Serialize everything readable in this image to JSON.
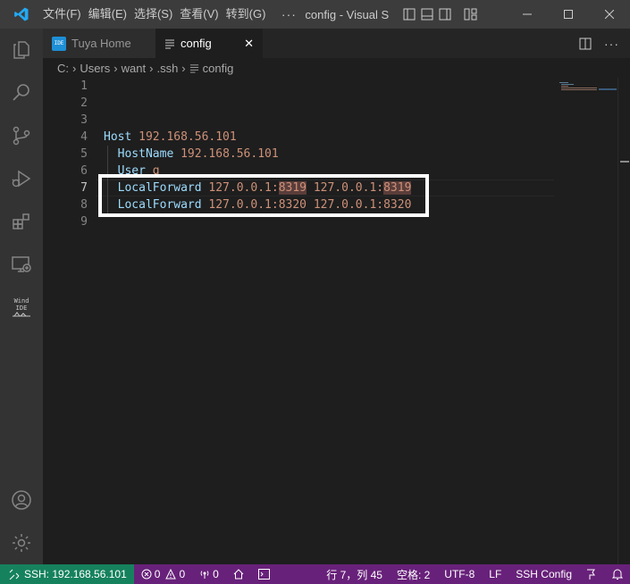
{
  "titlebar": {
    "menus": [
      "文件(F)",
      "编辑(E)",
      "选择(S)",
      "查看(V)",
      "转到(G)"
    ],
    "more": "···",
    "title": "config - Visual S"
  },
  "tabs": [
    {
      "label": "Tuya Home",
      "icon": "tuya-home-icon",
      "active": false
    },
    {
      "label": "config",
      "icon": "file-lines-icon",
      "active": true,
      "close": "✕"
    }
  ],
  "breadcrumb": [
    "C:",
    "Users",
    "want",
    ".ssh",
    "config"
  ],
  "activity_ide_label": [
    "Wind",
    "IDE"
  ],
  "editor": {
    "line_numbers": [
      "1",
      "2",
      "3",
      "4",
      "5",
      "6",
      "7",
      "8",
      "9"
    ],
    "current_line": 7,
    "lines": [
      {
        "n": 4,
        "indent": false,
        "key": "Host",
        "val": "192.168.56.101"
      },
      {
        "n": 5,
        "indent": true,
        "key": "HostName",
        "val": "192.168.56.101"
      },
      {
        "n": 6,
        "indent": true,
        "key": "User",
        "val": "g"
      },
      {
        "n": 7,
        "indent": true,
        "key": "LocalForward",
        "a": "127.0.0.1:",
        "b": "8319",
        "c": "127.0.0.1:",
        "d": "8319"
      },
      {
        "n": 8,
        "indent": true,
        "key": "LocalForward",
        "a": "127.0.0.1:",
        "b": "8320",
        "c": "127.0.0.1:",
        "d": "8320"
      }
    ]
  },
  "statusbar": {
    "remote": "SSH: 192.168.56.101",
    "errors": "0",
    "warnings": "0",
    "ports": "0",
    "position": "行 7，列 45",
    "indent": "空格: 2",
    "encoding": "UTF-8",
    "eol": "LF",
    "language": "SSH Config"
  },
  "colors": {
    "statusbar": "#68217a",
    "remote": "#16825d",
    "keyword": "#9cdcfe",
    "value": "#ce9178"
  }
}
